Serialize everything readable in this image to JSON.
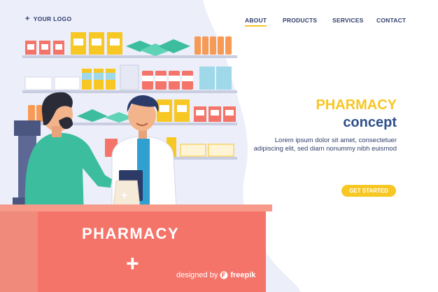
{
  "header": {
    "logo_text": "YOUR LOGO",
    "logo_icon": "plus-icon"
  },
  "nav": {
    "items": [
      {
        "label": "ABOUT",
        "active": true
      },
      {
        "label": "PRODUCTS",
        "active": false
      },
      {
        "label": "SERVICES",
        "active": false
      },
      {
        "label": "CONTACT",
        "active": false
      }
    ]
  },
  "hero": {
    "title_line1": "PHARMACY",
    "title_line2": "concept",
    "body": "Lorem ipsum dolor sit amet, consectetuer adipiscing elit, sed diam nonummy nibh euismod",
    "cta_label": "GET STARTED"
  },
  "illustration": {
    "counter_sign": "PHARMACY",
    "counter_symbol": "+",
    "bag_symbol": "+"
  },
  "footer": {
    "credit_prefix": "designed by",
    "credit_brand": "freepik"
  },
  "colors": {
    "accent_yellow": "#f7c724",
    "navy": "#2f3f6b",
    "title_blue": "#2f4f8c",
    "background_blob": "#eceefa",
    "counter_coral": "#f4746a",
    "customer_teal": "#3bbd9e",
    "pharmacist_coat": "#ffffff"
  }
}
